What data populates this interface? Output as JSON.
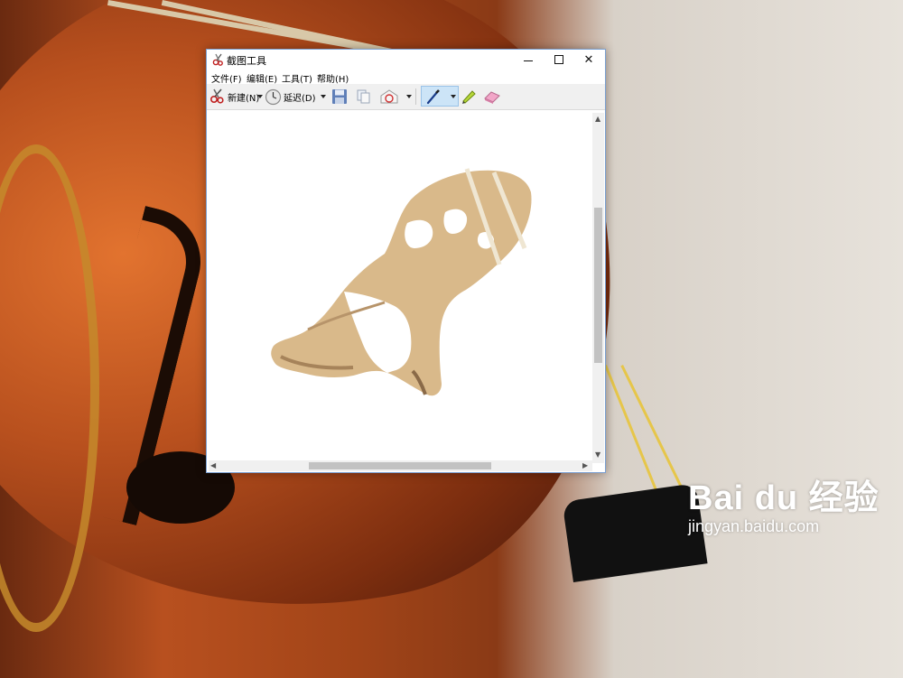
{
  "window": {
    "title": "截图工具"
  },
  "menu": {
    "file": "文件(F)",
    "edit": "编辑(E)",
    "tools": "工具(T)",
    "help": "帮助(H)"
  },
  "toolbar": {
    "new_label": "新建(N)",
    "delay_label": "延迟(D)"
  },
  "icons": {
    "app": "scissors-icon",
    "minimize": "minimize-icon",
    "maximize": "maximize-icon",
    "close": "close-icon",
    "new": "scissors-icon",
    "delay": "clock-icon",
    "save": "floppy-disk-icon",
    "copy": "copy-icon",
    "send": "send-mail-icon",
    "pen": "pen-icon",
    "highlighter": "highlighter-icon",
    "eraser": "eraser-icon"
  },
  "captured_image": {
    "description": "cello bridge with strings"
  },
  "watermark": {
    "logo": "Bai du 经验",
    "url": "jingyan.baidu.com"
  },
  "colors": {
    "accent": "#cce4f7",
    "window_border": "#7a9fd0"
  }
}
